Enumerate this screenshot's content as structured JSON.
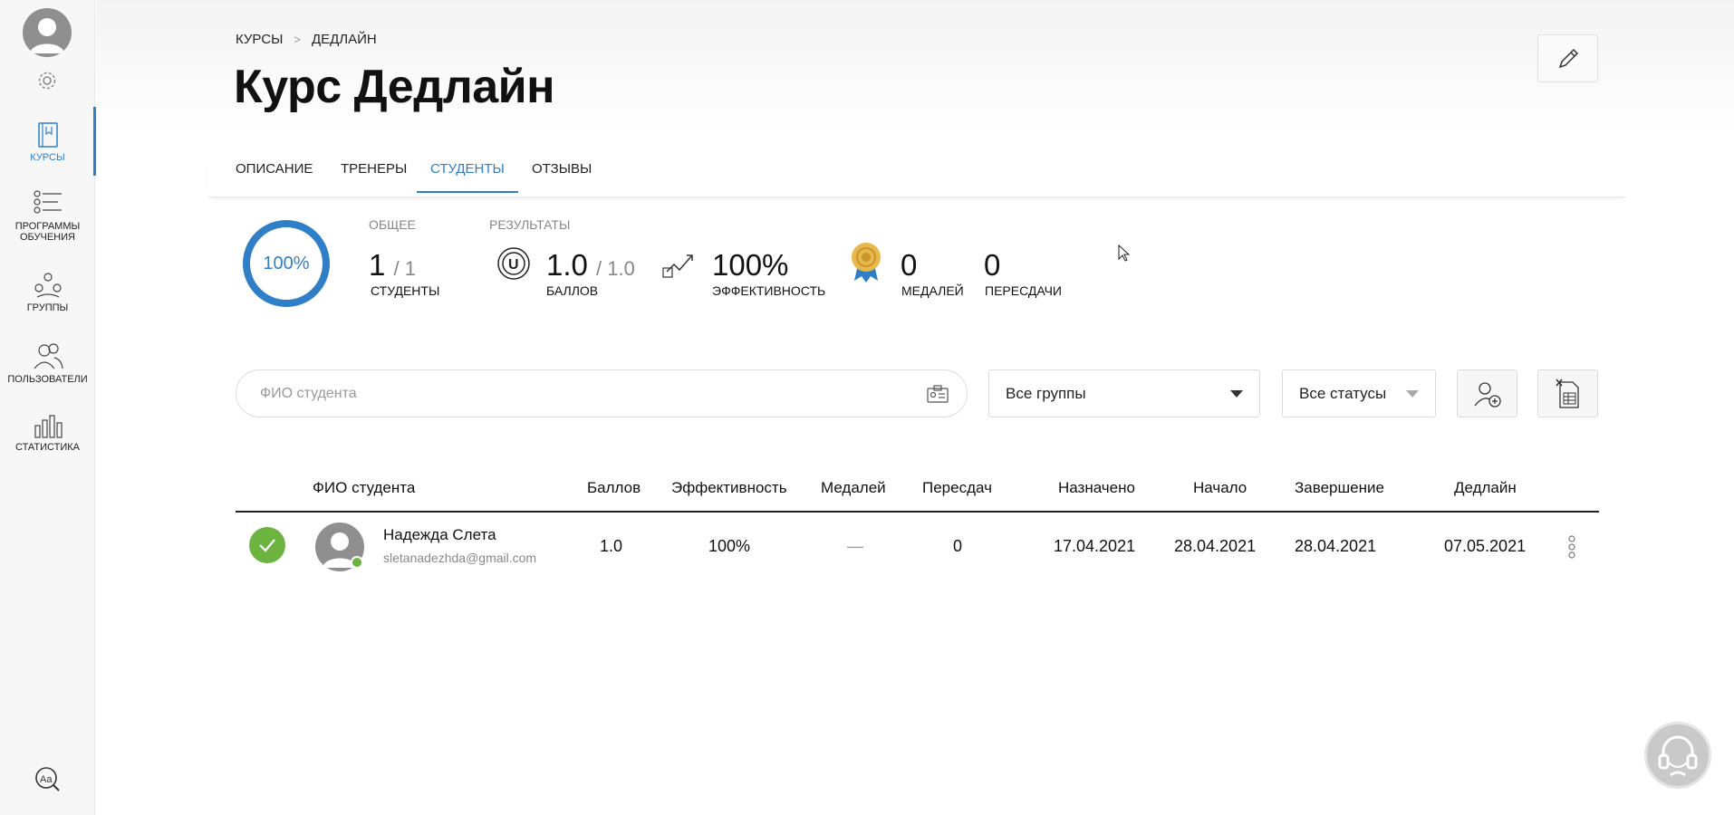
{
  "sidebar": {
    "items": [
      {
        "label": "КУРСЫ",
        "icon": "book-icon"
      },
      {
        "label": "ПРОГРАММЫ ОБУЧЕНИЯ",
        "icon": "checklist-icon"
      },
      {
        "label": "ГРУППЫ",
        "icon": "group-icon"
      },
      {
        "label": "ПОЛЬЗОВАТЕЛИ",
        "icon": "users-icon"
      },
      {
        "label": "СТАТИСТИКА",
        "icon": "bar-chart-icon"
      }
    ],
    "font_icon_text": "Aa"
  },
  "breadcrumb": {
    "root": "КУРСЫ",
    "current": "ДЕДЛАЙН",
    "separator": ">"
  },
  "page_title": "Курс Дедлайн",
  "tabs": [
    {
      "label": "ОПИСАНИЕ"
    },
    {
      "label": "ТРЕНЕРЫ"
    },
    {
      "label": "СТУДЕНТЫ"
    },
    {
      "label": "ОТЗЫВЫ"
    }
  ],
  "active_tab": "СТУДЕНТЫ",
  "stats": {
    "progress_percent": 100,
    "progress_label": "100%",
    "general_header": "ОБЩЕЕ",
    "results_header": "РЕЗУЛЬТАТЫ",
    "students_value": "1",
    "students_total": "/ 1",
    "students_caption": "СТУДЕНТЫ",
    "points_badge": "U",
    "points_value": "1.0",
    "points_total": "/ 1.0",
    "points_caption": "БАЛЛОВ",
    "efficiency_value": "100%",
    "efficiency_caption": "ЭФФЕКТИВНОСТЬ",
    "medals_value": "0",
    "medals_caption": "МЕДАЛЕЙ",
    "retakes_value": "0",
    "retakes_caption": "ПЕРЕСДАЧИ"
  },
  "filters": {
    "search_placeholder": "ФИО студента",
    "groups_select": "Все группы",
    "status_select": "Все статусы"
  },
  "table": {
    "columns": [
      "ФИО студента",
      "Баллов",
      "Эффективность",
      "Медалей",
      "Пересдач",
      "Назначено",
      "Начало",
      "Завершение",
      "Дедлайн"
    ],
    "rows": [
      {
        "name": "Надежда Слета",
        "email": "sletanadezhda@gmail.com",
        "points": "1.0",
        "efficiency": "100%",
        "medals": "—",
        "retakes": "0",
        "assigned": "17.04.2021",
        "start": "28.04.2021",
        "finish": "28.04.2021",
        "deadline": "07.05.2021"
      }
    ]
  },
  "colors": {
    "accent": "#2f7fc8",
    "success": "#6cb33f",
    "medal": "#e8b84a"
  }
}
